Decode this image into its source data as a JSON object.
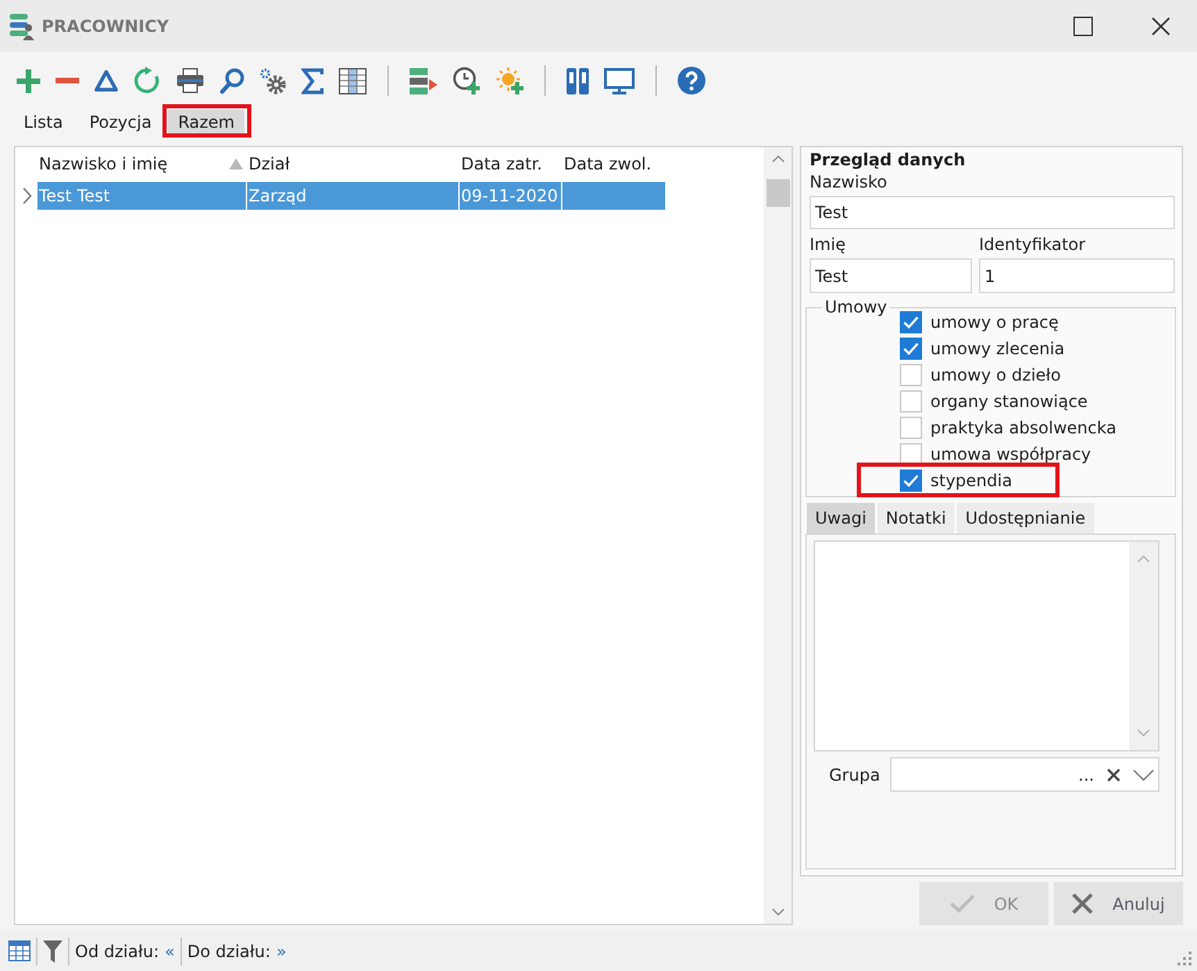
{
  "window": {
    "title": "PRACOWNICY"
  },
  "view_tabs": [
    {
      "label": "Lista",
      "selected": false,
      "highlighted": false
    },
    {
      "label": "Pozycja",
      "selected": false,
      "highlighted": false
    },
    {
      "label": "Razem",
      "selected": true,
      "highlighted": true
    }
  ],
  "table": {
    "columns": [
      {
        "label": "Nazwisko i imię",
        "sorted": true
      },
      {
        "label": "Dział",
        "sorted": false
      },
      {
        "label": "Data zatr.",
        "sorted": false
      },
      {
        "label": "Data zwol.",
        "sorted": false
      }
    ],
    "rows": [
      {
        "cells": [
          "Test Test",
          "Zarząd",
          "09-11-2020"
        ],
        "selected": true
      }
    ]
  },
  "details": {
    "title": "Przegląd danych",
    "fields": [
      {
        "label": "Nazwisko",
        "value": "Test"
      },
      {
        "label": "Imię",
        "value": "Test"
      },
      {
        "label": "Identyfikator",
        "value": "1"
      }
    ],
    "contracts": {
      "title": "Umowy",
      "items": [
        {
          "label": "umowy o pracę",
          "checked": true,
          "highlighted": false
        },
        {
          "label": "umowy zlecenia",
          "checked": true,
          "highlighted": false
        },
        {
          "label": "umowy o dzieło",
          "checked": false,
          "highlighted": false
        },
        {
          "label": "organy stanowiące",
          "checked": false,
          "highlighted": false
        },
        {
          "label": "praktyka absolwencka",
          "checked": false,
          "highlighted": false
        },
        {
          "label": "umowa współpracy",
          "checked": false,
          "highlighted": false
        },
        {
          "label": "stypendia",
          "checked": true,
          "highlighted": true
        }
      ]
    },
    "tabs": [
      {
        "label": "Uwagi",
        "selected": true
      },
      {
        "label": "Notatki",
        "selected": false
      },
      {
        "label": "Udostępnianie",
        "selected": false
      }
    ],
    "group_field": {
      "label": "Grupa",
      "ellipsis": "..."
    }
  },
  "buttons": [
    {
      "label": "OK",
      "kind": "ok",
      "disabled": true
    },
    {
      "label": "Anuluj",
      "kind": "cancel",
      "disabled": false
    }
  ],
  "status_bar": {
    "filters": [
      {
        "label": "Od działu:",
        "value": "«"
      },
      {
        "label": "Do działu:",
        "value": "»"
      }
    ]
  }
}
